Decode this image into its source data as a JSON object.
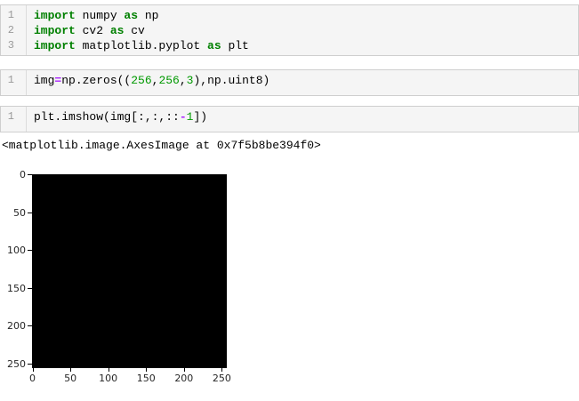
{
  "notebook": {
    "cells": [
      {
        "name": "imports-cell",
        "lines": [
          {
            "num": "1",
            "tokens": [
              [
                "keyword",
                "import"
              ],
              [
                "plain",
                " numpy "
              ],
              [
                "keyword",
                "as"
              ],
              [
                "plain",
                " np"
              ]
            ]
          },
          {
            "num": "2",
            "tokens": [
              [
                "keyword",
                "import"
              ],
              [
                "plain",
                " cv2 "
              ],
              [
                "keyword",
                "as"
              ],
              [
                "plain",
                " cv"
              ]
            ]
          },
          {
            "num": "3",
            "tokens": [
              [
                "keyword",
                "import"
              ],
              [
                "plain",
                " matplotlib.pyplot "
              ],
              [
                "keyword",
                "as"
              ],
              [
                "plain",
                " plt"
              ]
            ]
          }
        ]
      },
      {
        "name": "create-image-cell",
        "lines": [
          {
            "num": "1",
            "tokens": [
              [
                "plain",
                "img"
              ],
              [
                "operator",
                "="
              ],
              [
                "plain",
                "np.zeros(("
              ],
              [
                "number",
                "256"
              ],
              [
                "plain",
                ","
              ],
              [
                "number",
                "256"
              ],
              [
                "plain",
                ","
              ],
              [
                "number",
                "3"
              ],
              [
                "plain",
                "),np.uint8)"
              ]
            ]
          }
        ]
      },
      {
        "name": "imshow-cell",
        "lines": [
          {
            "num": "1",
            "tokens": [
              [
                "plain",
                "plt.imshow(img[:,:,::"
              ],
              [
                "operator",
                "-"
              ],
              [
                "number",
                "1"
              ],
              [
                "plain",
                "])"
              ]
            ]
          }
        ]
      }
    ],
    "output_repr": "<matplotlib.image.AxesImage at 0x7f5b8be394f0>"
  },
  "colors": {
    "keyword": "#008000",
    "number": "#009900",
    "operator": "#AA22FF",
    "cell_background": "#f5f5f5",
    "cell_border": "#cfcfcf",
    "gutter_divider": "#dcdcdc",
    "line_number": "#999999",
    "code_text": "#000000",
    "image_fill": "#000000"
  },
  "chart_data": {
    "type": "heatmap",
    "title": "",
    "xlabel": "",
    "ylabel": "",
    "x_ticks": [
      0,
      50,
      100,
      150,
      200,
      250
    ],
    "y_ticks": [
      0,
      50,
      100,
      150,
      200,
      250
    ],
    "xlim": [
      -0.5,
      255.5
    ],
    "ylim": [
      255.5,
      -0.5
    ],
    "grid": false,
    "legend": false,
    "image_fill": "#000000",
    "description": "uniform black 256x256 RGB image (all zeros) rendered by plt.imshow"
  }
}
